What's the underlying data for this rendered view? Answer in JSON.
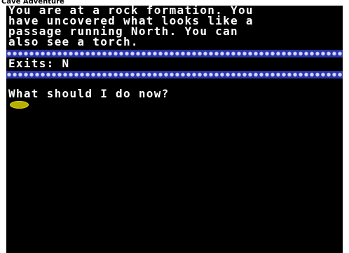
{
  "window": {
    "title": "Cave Adventure"
  },
  "game": {
    "description_lines": [
      "You are at a rock formation. You",
      "have uncovered what looks like a",
      "passage running North. You can",
      "also see a torch."
    ],
    "exits_line": "Exits: N",
    "prompt": "What should I do now?"
  },
  "colors": {
    "background": "#000000",
    "text": "#ffffff",
    "divider": "#2b33a8",
    "cursor": "#b8b000"
  },
  "icons": {
    "divider_pattern": "diamond-row",
    "input_cursor": "blinking-oval-cursor"
  }
}
